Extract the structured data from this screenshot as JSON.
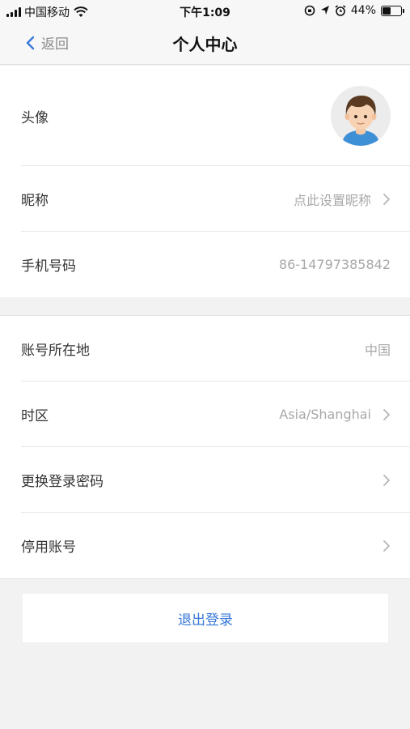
{
  "status_bar": {
    "carrier": "中国移动",
    "time": "下午1:09",
    "battery_percent": "44%",
    "battery_level": 0.44
  },
  "nav": {
    "back_label": "返回",
    "title": "个人中心"
  },
  "profile": {
    "avatar_label": "头像",
    "nickname_label": "昵称",
    "nickname_value": "点此设置昵称",
    "phone_label": "手机号码",
    "phone_value": "86-14797385842"
  },
  "account": {
    "region_label": "账号所在地",
    "region_value": "中国",
    "timezone_label": "时区",
    "timezone_value": "Asia/Shanghai",
    "change_password_label": "更换登录密码",
    "disable_account_label": "停用账号"
  },
  "logout_label": "退出登录",
  "colors": {
    "accent": "#3878d8",
    "background": "#f2f2f2"
  }
}
